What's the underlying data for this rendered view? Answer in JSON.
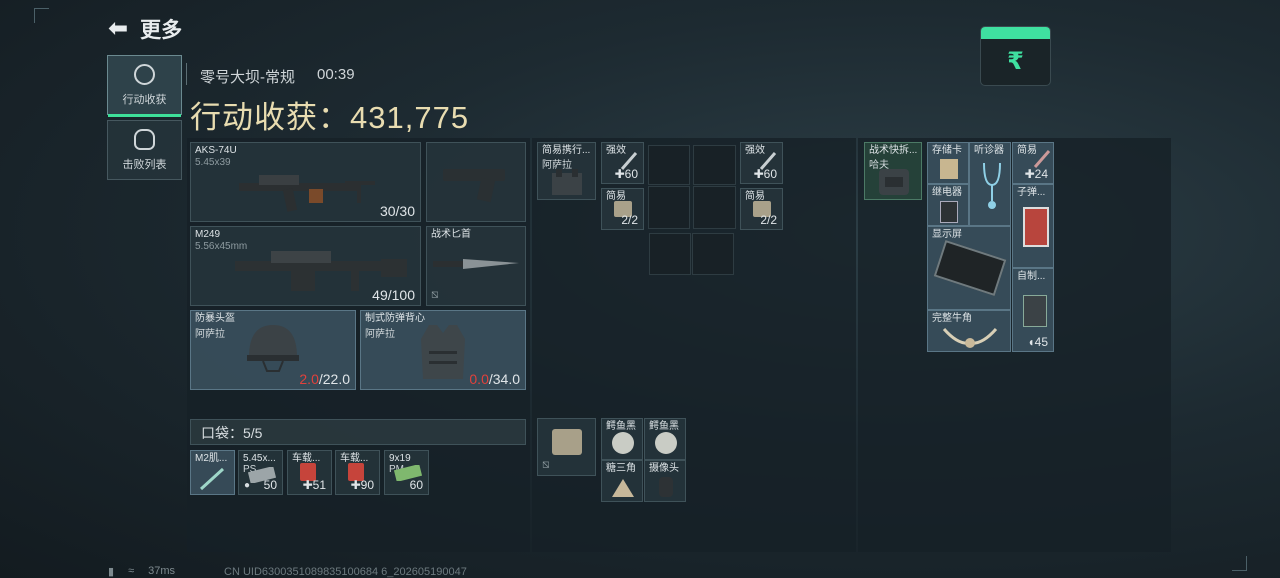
{
  "header": {
    "back_label": "更多"
  },
  "tabs": [
    {
      "label": "行动收获",
      "icon": "compass-icon",
      "active": true
    },
    {
      "label": "击败列表",
      "icon": "skull-icon",
      "active": false
    }
  ],
  "match": {
    "map": "零号大坝-常规",
    "time": "00:39"
  },
  "loot": {
    "label": "行动收获：",
    "value": "431,775"
  },
  "currency": {
    "symbol": "₹",
    "accent": "#3fe0a0"
  },
  "weapons": [
    {
      "name": "AKS-74U",
      "caliber": "5.45x39",
      "ammo": "30/30"
    },
    {
      "name": "M249",
      "caliber": "5.56x45mm",
      "ammo": "49/100"
    }
  ],
  "pistol": {
    "name": ""
  },
  "knife": {
    "name": "战术匕首"
  },
  "helmet": {
    "name": "防暴头盔",
    "sub": "阿萨拉",
    "durability": "2.0",
    "max": "/22.0"
  },
  "vest": {
    "name": "制式防弹背心",
    "sub": "阿萨拉",
    "durability": "0.0",
    "max": "/34.0"
  },
  "rig": {
    "name": "简易携行...",
    "sub": "阿萨拉",
    "items": [
      {
        "label": "强效",
        "count": "60"
      },
      {
        "label": "简易",
        "count": "2/2"
      },
      {
        "label": "强效",
        "count": "60"
      },
      {
        "label": "简易",
        "count": "2/2"
      }
    ]
  },
  "backpack": {
    "name": "战术快拆...",
    "sub": "哈夫",
    "items": [
      {
        "label": "存储卡"
      },
      {
        "label": "听诊器"
      },
      {
        "label": "简易",
        "count": "24"
      },
      {
        "label": "继电器"
      },
      {
        "label": "子弹..."
      },
      {
        "label": "显示屏"
      },
      {
        "label": "自制..."
      },
      {
        "label": "完整牛角"
      },
      {
        "count": "45"
      }
    ]
  },
  "pouch": {
    "label": "口袋：",
    "count": "5/5"
  },
  "pouch_items": [
    {
      "label": "M2肌...",
      "count": ""
    },
    {
      "label": "5.45x...",
      "sub": "PS",
      "count": "50"
    },
    {
      "label": "车载...",
      "count": "51"
    },
    {
      "label": "车载...",
      "count": "90"
    },
    {
      "label": "9x19",
      "sub": "PM",
      "count": "60"
    }
  ],
  "safe_items": [
    {
      "label": "鳄鱼黑"
    },
    {
      "label": "鳄鱼黑"
    },
    {
      "label": "糖三角"
    },
    {
      "label": "摄像头"
    }
  ],
  "status": {
    "ping": "37ms",
    "uid": "CN UID6300351089835100684 6_202605190047"
  }
}
